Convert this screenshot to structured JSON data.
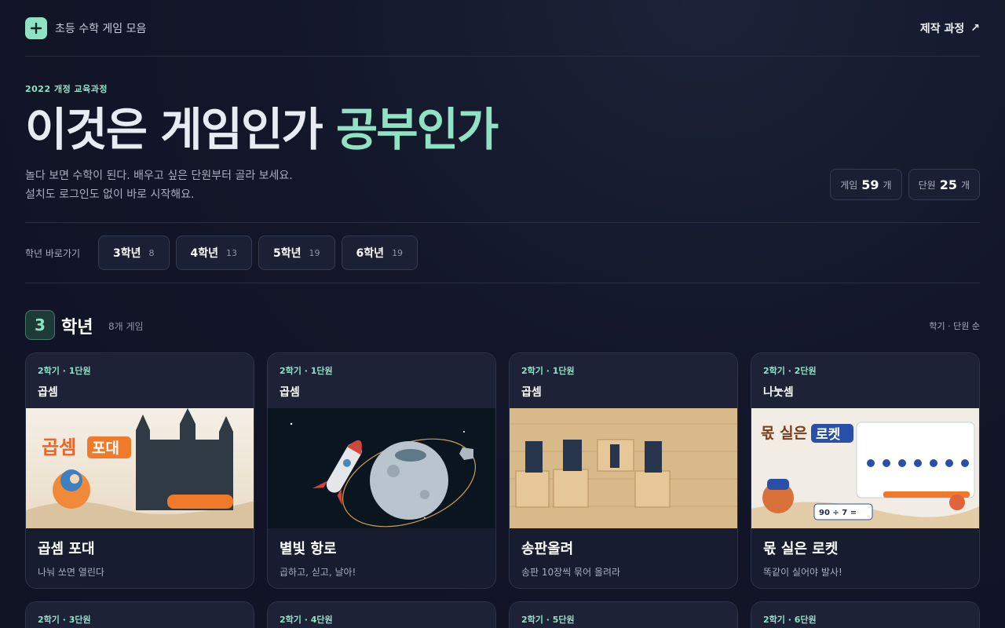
{
  "header": {
    "brand": "초등 수학 게임 모음",
    "making_link": "제작 과정",
    "making_arrow": "↗"
  },
  "hero": {
    "eyebrow": "2022 개정 교육과정",
    "title_plain": "이것은 게임인가",
    "title_accent": "공부인가",
    "desc_line1": "놀다 보면 수학이 된다. 배우고 싶은 단원부터 골라 보세요.",
    "desc_line2": "설치도 로그인도 없이 바로 시작해요.",
    "stats": [
      {
        "label": "게임",
        "value": "59",
        "unit": "개"
      },
      {
        "label": "단원",
        "value": "25",
        "unit": "개"
      }
    ]
  },
  "grade_nav": {
    "label": "학년 바로가기",
    "grades": [
      {
        "label": "3학년",
        "count": "8"
      },
      {
        "label": "4학년",
        "count": "13"
      },
      {
        "label": "5학년",
        "count": "19"
      },
      {
        "label": "6학년",
        "count": "19"
      }
    ]
  },
  "section": {
    "number": "3",
    "title": "학년",
    "count": "8개 게임",
    "sort": "학기 · 단원 순"
  },
  "cards": [
    {
      "unit": "2학기 · 1단원",
      "topic": "곱셈",
      "title": "곱셈 포대",
      "subtitle": "나눠 쏘면 열린다",
      "thumb_text": "곱셈",
      "thumb_text2": "포대"
    },
    {
      "unit": "2학기 · 1단원",
      "topic": "곱셈",
      "title": "별빛 항로",
      "subtitle": "곱하고, 싣고, 날아!"
    },
    {
      "unit": "2학기 · 1단원",
      "topic": "곱셈",
      "title": "송판올려",
      "subtitle": "송판 10장씩 묶어 올려라"
    },
    {
      "unit": "2학기 · 2단원",
      "topic": "나눗셈",
      "title": "몫 실은 로켓",
      "subtitle": "똑같이 실어야 발사!",
      "thumb_text": "몫 실은",
      "thumb_text2": "로켓",
      "thumb_eq": "90 ÷ 7 ="
    }
  ],
  "cards_row2": [
    {
      "unit": "2학기 · 3단원"
    },
    {
      "unit": "2학기 · 4단원"
    },
    {
      "unit": "2학기 · 5단원"
    },
    {
      "unit": "2학기 · 6단원"
    }
  ],
  "colors": {
    "accent": "#8fe3c4",
    "background": "#121628",
    "card": "#171c2f"
  }
}
